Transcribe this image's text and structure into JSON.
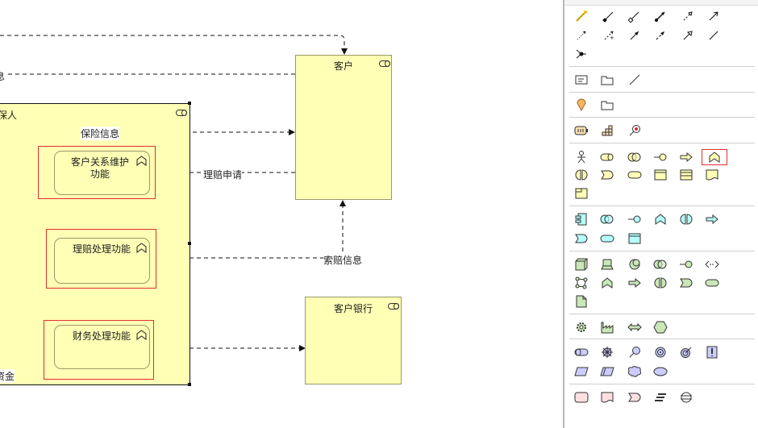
{
  "diagram": {
    "nodes": {
      "customer": "客户",
      "insurer": "保人",
      "customer_bank": "客户银行",
      "crm_func": "客户关系维护\n功能",
      "claim_func": "理赔处理功能",
      "finance_func": "财务处理功能"
    },
    "edges": {
      "insurance_info": "保险信息",
      "claim_request": "理赔申请",
      "claim_info": "索赔信息",
      "left_info": "息",
      "funds": "资金"
    }
  },
  "palette": {
    "selected_tool": "business-function-tool"
  }
}
